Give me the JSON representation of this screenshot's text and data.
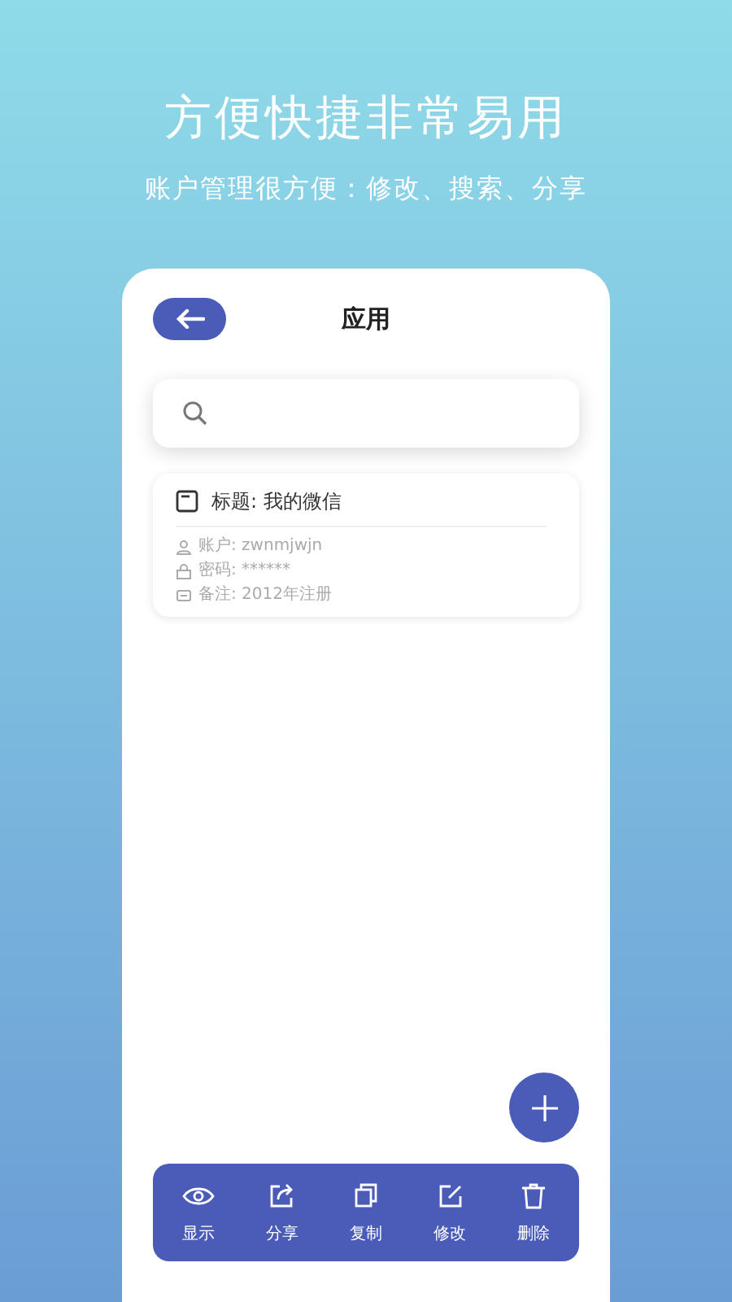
{
  "headline": "方便快捷非常易用",
  "subtitle": "账户管理很方便：修改、搜索、分享",
  "app": {
    "title": "应用",
    "entries": [
      {
        "title": "标题: 我的微信",
        "fields": [
          {
            "kind": "account",
            "text": "账户: zwnmjwjn"
          },
          {
            "kind": "password",
            "text": "密码: ******"
          },
          {
            "kind": "note",
            "text": "备注: 2012年注册"
          }
        ]
      }
    ],
    "toolbar": [
      {
        "kind": "show",
        "label": "显示"
      },
      {
        "kind": "share",
        "label": "分享"
      },
      {
        "kind": "copy",
        "label": "复制"
      },
      {
        "kind": "edit",
        "label": "修改"
      },
      {
        "kind": "delete",
        "label": "删除"
      }
    ]
  }
}
